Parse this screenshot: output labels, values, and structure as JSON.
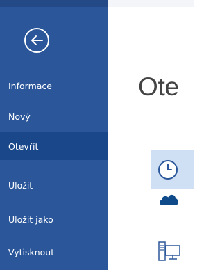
{
  "nav": {
    "back_icon": "back-arrow-circle-icon",
    "items": [
      {
        "label": "Informace"
      },
      {
        "label": "Nový"
      },
      {
        "label": "Otevřít"
      },
      {
        "label": "Uložit"
      },
      {
        "label": "Uložit jako"
      },
      {
        "label": "Vytisknout"
      }
    ],
    "active_index": 2
  },
  "main": {
    "title": "Ote",
    "places": [
      {
        "icon": "clock-icon",
        "selected": true
      },
      {
        "icon": "cloud-icon",
        "selected": false
      },
      {
        "icon": "computer-icon",
        "selected": false
      }
    ]
  },
  "colors": {
    "nav_background": "#2b579a",
    "nav_active": "#19478a",
    "selected_place": "#cfe0f5",
    "icon_blue": "#2b579a"
  }
}
